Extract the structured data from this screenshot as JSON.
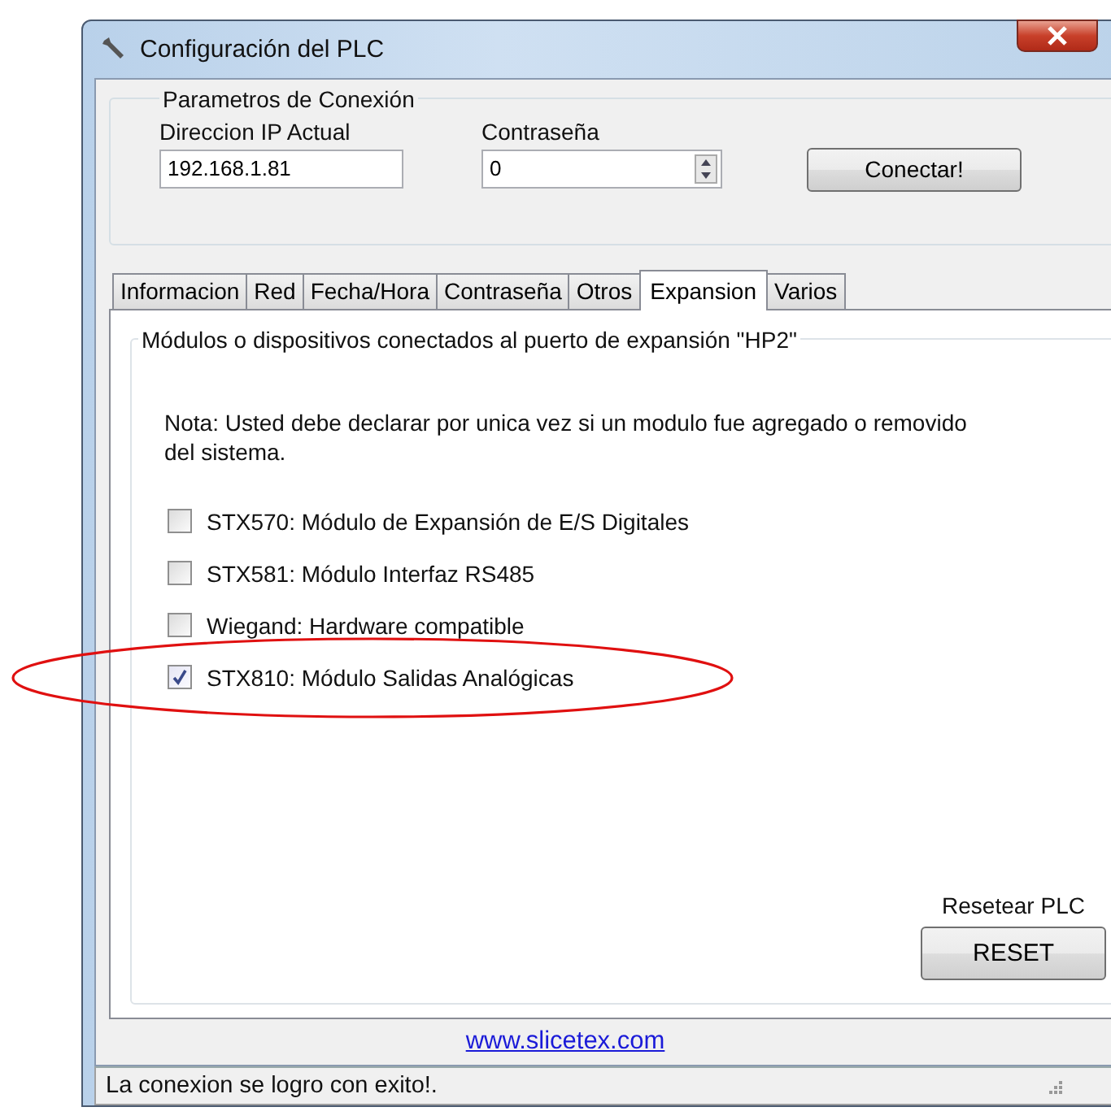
{
  "window": {
    "title": "Configuración del PLC"
  },
  "connection": {
    "title": "Parametros de Conexión",
    "ip_label": "Direccion IP Actual",
    "ip_value": "192.168.1.81",
    "password_label": "Contraseña",
    "password_value": "0",
    "connect_button": "Conectar!"
  },
  "tabs": [
    {
      "label": "Informacion",
      "selected": false
    },
    {
      "label": "Red",
      "selected": false
    },
    {
      "label": "Fecha/Hora",
      "selected": false
    },
    {
      "label": "Contraseña",
      "selected": false
    },
    {
      "label": "Otros",
      "selected": false
    },
    {
      "label": "Expansion",
      "selected": true
    },
    {
      "label": "Varios",
      "selected": false
    }
  ],
  "expansion": {
    "title": "Módulos o dispositivos conectados al puerto de expansión \"HP2\"",
    "note": "Nota: Usted debe declarar por unica vez si un modulo fue agregado o removido del sistema.",
    "modules": [
      {
        "label": "STX570: Módulo de Expansión de E/S Digitales",
        "checked": false,
        "circled": false
      },
      {
        "label": "STX581: Módulo Interfaz RS485",
        "checked": false,
        "circled": false
      },
      {
        "label": "Wiegand: Hardware compatible",
        "checked": false,
        "circled": false
      },
      {
        "label": "STX810: Módulo Salidas Analógicas",
        "checked": true,
        "circled": true
      }
    ],
    "reset_label": "Resetear PLC",
    "reset_button": "RESET"
  },
  "link": "www.slicetex.com",
  "status_bar": "La conexion se logro con exito!."
}
